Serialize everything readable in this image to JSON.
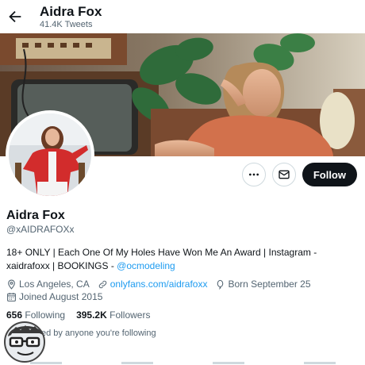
{
  "header": {
    "name": "Aidra Fox",
    "tweet_count": "41.4K Tweets"
  },
  "actions": {
    "follow_label": "Follow"
  },
  "profile": {
    "name": "Aidra Fox",
    "handle": "@xAIDRAFOXx",
    "bio_text": "18+ ONLY | Each One Of My Holes Have Won Me An Award | Instagram - xaidrafoxx | BOOKINGS - ",
    "bio_link": "@ocmodeling",
    "location": "Los Angeles, CA",
    "website": "onlyfans.com/aidrafoxx",
    "birthday": "Born September 25",
    "joined": "Joined August 2015",
    "following_count": "656",
    "following_label": "Following",
    "followers_count": "395.2K",
    "followers_label": "Followers",
    "followed_by": "ed by anyone you're following"
  },
  "colors": {
    "accent": "#1d9bf0",
    "text": "#0f1419",
    "muted": "#536471",
    "follow_button_bg": "#0f1419"
  }
}
